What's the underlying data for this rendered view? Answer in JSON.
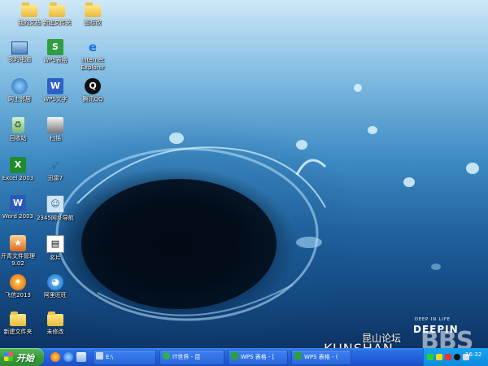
{
  "desktop_icons": [
    {
      "label": "我的文档",
      "icon": "folder-icon"
    },
    {
      "label": "新建文件夹",
      "icon": "folder-icon"
    },
    {
      "label": "图标改",
      "icon": "folder-icon"
    },
    {
      "label": "我的电脑",
      "icon": "my-computer-icon"
    },
    {
      "label": "WPS表格",
      "icon": "wps-spreadsheet-icon",
      "glyph": "S"
    },
    {
      "label": "Internet\nExplorer",
      "icon": "internet-explorer-icon",
      "glyph": "e"
    },
    {
      "label": "网上邻居",
      "icon": "network-icon"
    },
    {
      "label": "WPS文字",
      "icon": "wps-writer-icon",
      "glyph": "W"
    },
    {
      "label": "腾讯QQ",
      "icon": "qq-icon",
      "glyph": "Q"
    },
    {
      "label": "回收站",
      "icon": "recycle-bin-icon",
      "glyph": "♻"
    },
    {
      "label": "扫描",
      "icon": "scanner-icon"
    },
    {
      "label": "Excel 2003",
      "icon": "excel-icon",
      "glyph": "X"
    },
    {
      "label": "迅雷7",
      "icon": "thunder-icon",
      "glyph": "➶"
    },
    {
      "label": "Word 2003",
      "icon": "word-icon",
      "glyph": "W"
    },
    {
      "label": "2345网址导航",
      "icon": "navigation-icon",
      "glyph": "☺"
    },
    {
      "label": "开青文件管理\n9.02",
      "icon": "file-manager-icon",
      "glyph": "★"
    },
    {
      "label": "名片",
      "icon": "business-card-icon",
      "glyph": "▤"
    },
    {
      "label": "飞信2013",
      "icon": "fetion-icon",
      "glyph": "✦"
    },
    {
      "label": "阿里旺旺",
      "icon": "aliwangwang-icon",
      "glyph": "◕"
    },
    {
      "label": "新建文件夹",
      "icon": "folder-icon"
    },
    {
      "label": "未修改",
      "icon": "folder-icon"
    }
  ],
  "wallpaper": {
    "brand_sub": "DEEP IN LIFE",
    "brand": "DEEPIN",
    "forum_cn": "昆山论坛",
    "forum_en": "KUNSHAN",
    "forum_big": "BBS"
  },
  "taskbar": {
    "start_label": "开始",
    "tasks": [
      {
        "label": "E:\\",
        "icon": "drive-icon"
      },
      {
        "label": "IT世界 - 昆",
        "icon": "browser-icon"
      },
      {
        "label": "WPS 表格 - [",
        "icon": "wps-spreadsheet-icon"
      },
      {
        "label": "WPS 表格 - (",
        "icon": "wps-spreadsheet-icon"
      }
    ],
    "clock": "16:32"
  },
  "colors": {
    "taskbar": "#245edb",
    "start_button": "#3a9b3d",
    "tray": "#0d8be0"
  }
}
